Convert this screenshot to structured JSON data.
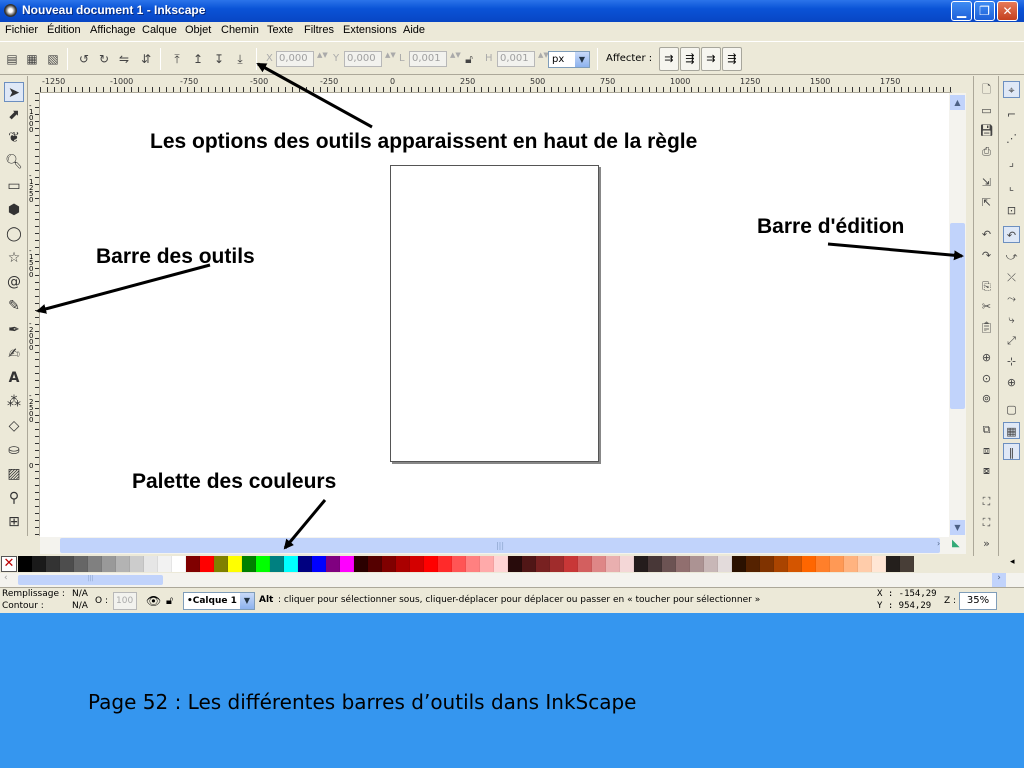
{
  "window": {
    "title": "Nouveau document 1 - Inkscape"
  },
  "menubar": {
    "items": [
      "Fichier",
      "Édition",
      "Affichage",
      "Calque",
      "Objet",
      "Chemin",
      "Texte",
      "Filtres",
      "Extensions",
      "Aide"
    ]
  },
  "toolcontrols": {
    "x_label": "X",
    "x_value": "0,000",
    "y_label": "Y",
    "y_value": "0,000",
    "w_label": "L",
    "w_value": "0,001",
    "h_label": "H",
    "h_value": "0,001",
    "unit": "px",
    "affecter_label": "Affecter :"
  },
  "hruler": {
    "labels": [
      "-1250",
      "-1000",
      "-750",
      "-500",
      "-250",
      "0",
      "250",
      "500",
      "750",
      "1000",
      "1250",
      "1500",
      "1750"
    ]
  },
  "vruler": {
    "labels": [
      "-1000",
      "-1250",
      "-1500",
      "-1750",
      "-1750",
      "-2000",
      "-2250",
      "-2500",
      "-2750",
      "0"
    ]
  },
  "annotations": {
    "options": "Les options des outils apparaissent en haut de la règle",
    "edition": "Barre d'édition",
    "outils": "Barre des outils",
    "palette": "Palette des couleurs"
  },
  "palette": {
    "colors": [
      "#000000",
      "#1a1a1a",
      "#333333",
      "#4d4d4d",
      "#666666",
      "#808080",
      "#999999",
      "#b3b3b3",
      "#cccccc",
      "#e6e6e6",
      "#f2f2f2",
      "#ffffff",
      "#800000",
      "#ff0000",
      "#808000",
      "#ffff00",
      "#008000",
      "#00ff00",
      "#008080",
      "#00ffff",
      "#000080",
      "#0000ff",
      "#800080",
      "#ff00ff",
      "#2b0000",
      "#550000",
      "#800000",
      "#aa0000",
      "#d40000",
      "#ff0000",
      "#ff2a2a",
      "#ff5555",
      "#ff8080",
      "#ffaaaa",
      "#ffd5d5",
      "#280b0b",
      "#501616",
      "#782121",
      "#a02c2c",
      "#c83737",
      "#d35f5f",
      "#de8787",
      "#e9afaf",
      "#f4d7d7",
      "#241c1c",
      "#483737",
      "#6c5353",
      "#916f6f",
      "#ac9393",
      "#c8b7b7",
      "#e3dbdb",
      "#2b1100",
      "#552200",
      "#803300",
      "#aa4400",
      "#d45500",
      "#ff6600",
      "#ff7f2a",
      "#ff9955",
      "#ffb380",
      "#ffccaa",
      "#ffe6d5",
      "#241f1c",
      "#48 3e37"
    ]
  },
  "statusbar": {
    "fill_label": "Remplissage :",
    "fill_value": "N/A",
    "stroke_label": "Contour :",
    "stroke_value": "N/A",
    "opacity_label": "O :",
    "opacity_value": "100",
    "layer": "•Calque 1",
    "hint_bold": "Alt",
    "hint": ": cliquer pour sélectionner sous, cliquer-déplacer pour déplacer ou passer en « toucher pour sélectionner »",
    "coord_x": "X : -154,29",
    "coord_y": "Y :  954,29",
    "zoom_label": "Z :",
    "zoom_value": "35%"
  },
  "caption": "Page 52 : Les différentes barres d’outils dans InkScape"
}
